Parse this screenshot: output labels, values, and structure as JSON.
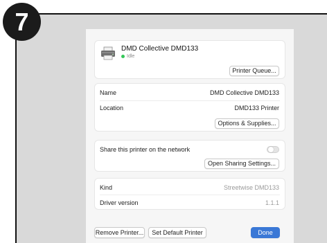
{
  "step": {
    "number": "7"
  },
  "printer": {
    "name": "DMD Collective DMD133",
    "status": "Idle",
    "status_color": "#34c759",
    "queue_button": "Printer Queue..."
  },
  "info": {
    "name_label": "Name",
    "name_value": "DMD Collective DMD133",
    "location_label": "Location",
    "location_value": "DMD133 Printer",
    "options_button": "Options & Supplies..."
  },
  "sharing": {
    "label": "Share this printer on the network",
    "enabled": false,
    "button": "Open Sharing Settings..."
  },
  "details": {
    "kind_label": "Kind",
    "kind_value": "Streetwise DMD133",
    "driver_label": "Driver version",
    "driver_value": "1.1.1"
  },
  "footer": {
    "remove_button": "Remove Printer...",
    "default_button": "Set Default Printer",
    "done_button": "Done"
  },
  "colors": {
    "accent": "#3a78d6",
    "badge": "#1b1b1b"
  },
  "icons": {
    "printer": "printer-icon",
    "toggle": "toggle-switch"
  }
}
